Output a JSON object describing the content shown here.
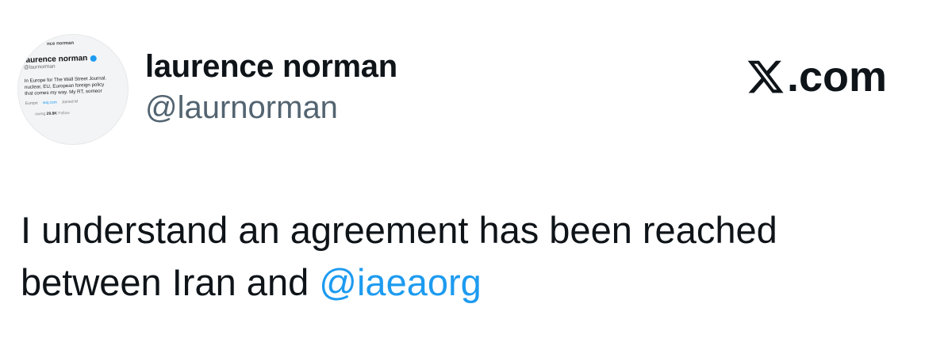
{
  "author": {
    "display_name": "laurence norman",
    "handle": "@laurnorman"
  },
  "brand": {
    "label": ".com"
  },
  "avatar": {
    "top_name": "nce norman",
    "name": "laurence norman",
    "handle": "@laurnorman",
    "bio_line1": "In Europe for The Wall Street Journal.",
    "bio_line2": "nuclear, EU, European foreign policy",
    "bio_line3": "that comes my way. My RT, someor",
    "meta_location": "Europe",
    "meta_link": "wsj.com",
    "meta_joined": "Joined M",
    "follow_label": "owing",
    "follow_count": "29.8K",
    "follow_suffix": "Follow"
  },
  "tweet": {
    "text_before": "I understand an agreement has been reached between Iran and ",
    "mention": "@iaeaorg"
  },
  "colors": {
    "text": "#0f1419",
    "secondary": "#536471",
    "link": "#1d9bf0"
  }
}
